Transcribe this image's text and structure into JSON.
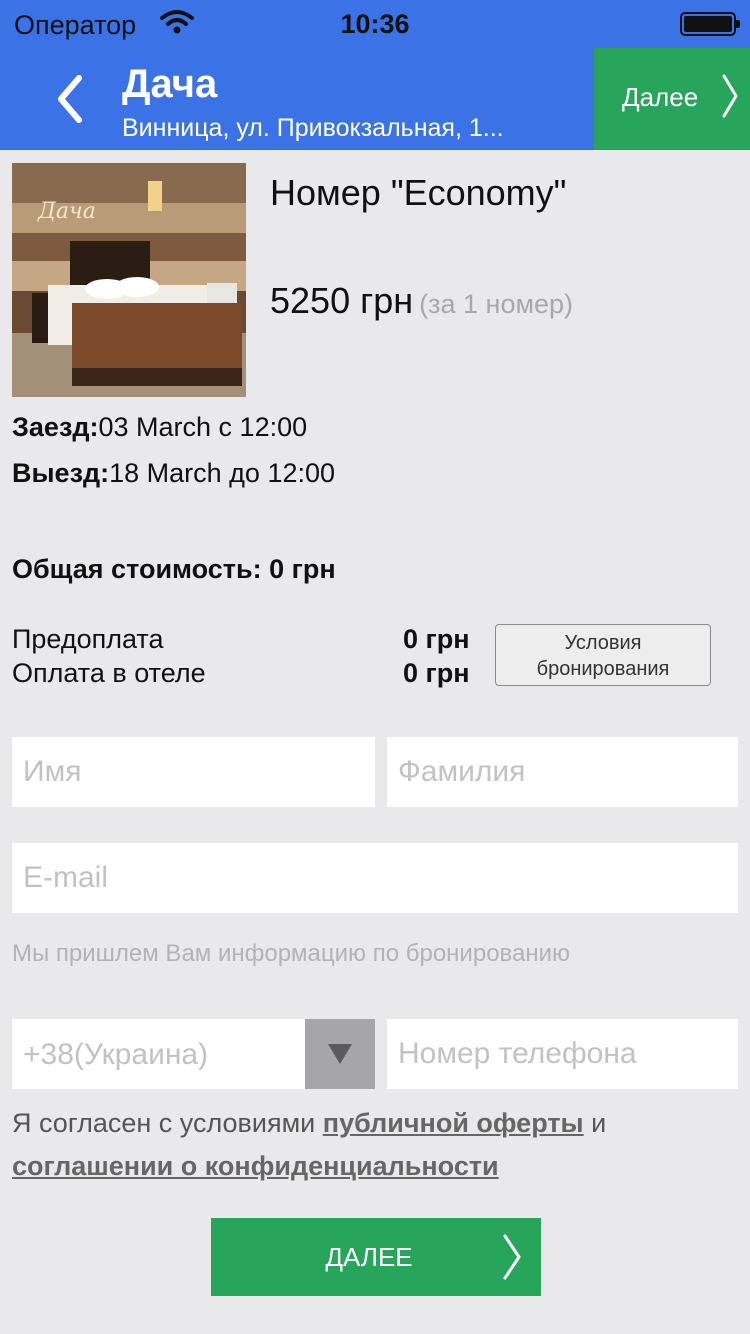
{
  "status_bar": {
    "carrier": "Оператор",
    "time": "10:36"
  },
  "header": {
    "title": "Дача",
    "subtitle": "Винница, ул. Привокзальная, 1...",
    "next_label": "Далее",
    "accent": "#3b73e6",
    "button_color": "#27a55b"
  },
  "room": {
    "name": "Номер \"Economy\"",
    "price": "5250 грн",
    "price_note": "(за 1 номер)",
    "photo_logo": "Дача"
  },
  "dates": {
    "checkin_label": "Заезд:",
    "checkin_value": "03 March с 12:00",
    "checkout_label": "Выезд:",
    "checkout_value": "18 March до 12:00"
  },
  "total": {
    "label": "Общая стоимость:",
    "value": "0 грн"
  },
  "payment": {
    "prepay_label": "Предоплата",
    "prepay_value": "0 грн",
    "hotel_label": "Оплата в отеле",
    "hotel_value": "0 грн",
    "terms_line1": "Условия",
    "terms_line2": "бронирования"
  },
  "form": {
    "first_name_placeholder": "Имя",
    "last_name_placeholder": "Фамилия",
    "email_placeholder": "E-mail",
    "email_hint": "Мы пришлем Вам информацию по бронированию",
    "country": "+38(Украина)",
    "phone_placeholder": "Номер телефона"
  },
  "agreement": {
    "prefix": "Я согласен с условиями",
    "offer_link": "публичной оферты",
    "conjunction": "и",
    "privacy_link": "соглашении о конфиденциальности"
  },
  "cta": {
    "label": "ДАЛЕЕ"
  }
}
